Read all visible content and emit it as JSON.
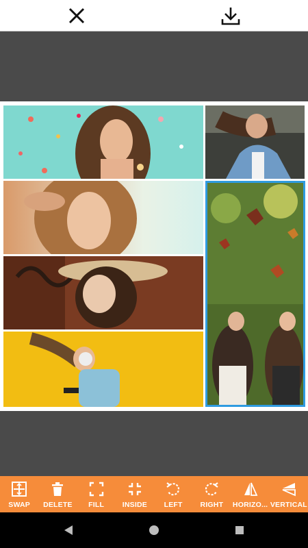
{
  "topbar": {
    "close_icon": "close-icon",
    "download_icon": "download-icon"
  },
  "collage": {
    "selected_cell": "cell-right-bottom",
    "cells": [
      {
        "name": "photo-confetti-woman"
      },
      {
        "name": "photo-denim-jacket-woman"
      },
      {
        "name": "photo-sun-woman"
      },
      {
        "name": "photo-hat-woman"
      },
      {
        "name": "photo-headphones-woman"
      },
      {
        "name": "photo-autumn-leaves-friends"
      }
    ]
  },
  "toolbar": {
    "color": "#f68c3a",
    "items": [
      {
        "label": "SWAP",
        "icon": "swap-icon"
      },
      {
        "label": "DELETE",
        "icon": "trash-icon"
      },
      {
        "label": "FILL",
        "icon": "fill-icon"
      },
      {
        "label": "INSIDE",
        "icon": "inside-icon"
      },
      {
        "label": "LEFT",
        "icon": "rotate-left-icon"
      },
      {
        "label": "RIGHT",
        "icon": "rotate-right-icon"
      },
      {
        "label": "HORIZO...",
        "icon": "flip-horizontal-icon"
      },
      {
        "label": "VERTICAL",
        "icon": "flip-vertical-icon"
      }
    ]
  },
  "navbar": {
    "back_icon": "back-triangle-icon",
    "home_icon": "home-circle-icon",
    "recents_icon": "recents-square-icon"
  }
}
